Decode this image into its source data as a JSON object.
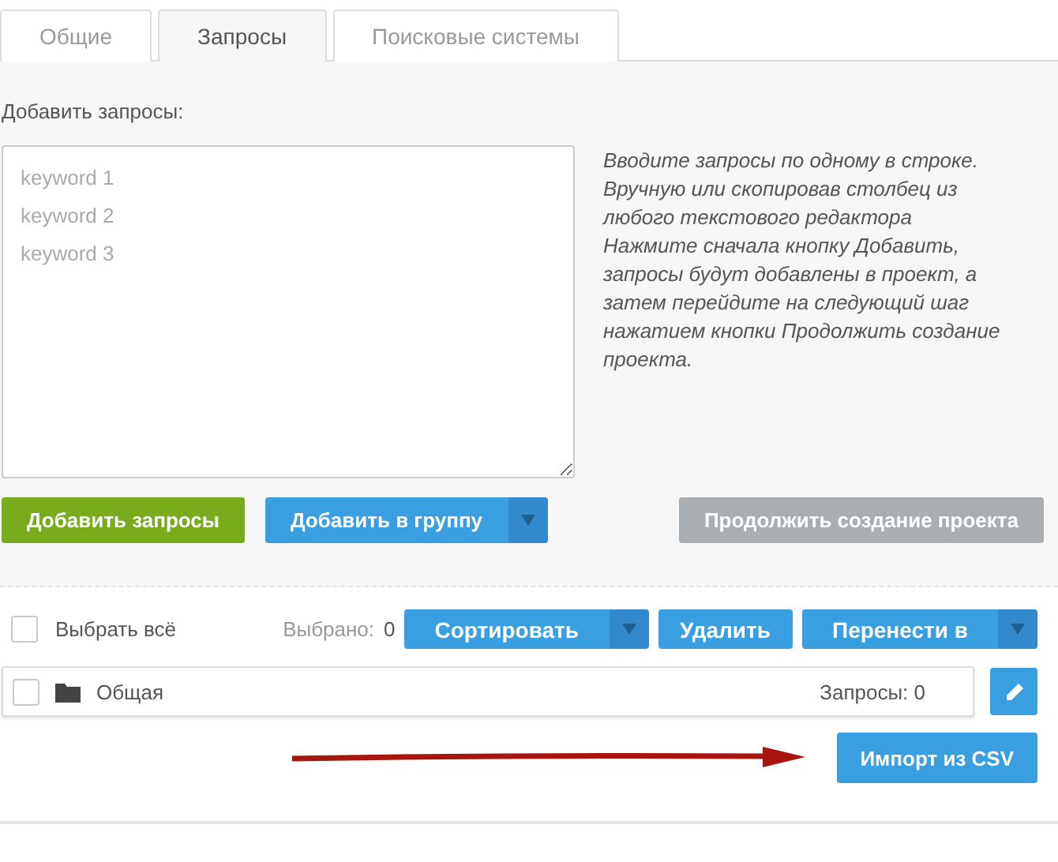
{
  "tabs": [
    {
      "label": "Общие",
      "selected": false
    },
    {
      "label": "Запросы",
      "selected": true
    },
    {
      "label": "Поисковые системы",
      "selected": false
    }
  ],
  "editor": {
    "label": "Добавить запросы:",
    "placeholder": "keyword 1\nkeyword 2\nkeyword 3",
    "hint": [
      "Вводите запросы по одному в строке. Вручную или скопировав столбец из любого текстового редактора",
      "Нажмите сначала кнопку Добавить, запросы будут добавлены в проект, а затем перейдите на следующий шаг нажатием кнопки Продолжить создание проекта."
    ],
    "buttons": [
      {
        "label": "Добавить запросы",
        "kind": "accent"
      },
      {
        "label": "Добавить в группу",
        "kind": "split"
      },
      {
        "label": "Продолжить создание проекта",
        "kind": "muted"
      }
    ]
  },
  "toolbar": {
    "select_all": {
      "label": "Выбрать всё",
      "checked": false
    },
    "selected_label": "Выбрано:",
    "selected_count": "0",
    "buttons": [
      {
        "label": "Сортировать",
        "kind": "split"
      },
      {
        "label": "Удалить",
        "kind": "plain"
      },
      {
        "label": "Перенести в",
        "kind": "split"
      }
    ]
  },
  "groups": [
    {
      "name": "Общая",
      "checked": false,
      "count_label": "Запросы:",
      "count": "0"
    }
  ],
  "import_button": {
    "label": "Импорт из CSV"
  }
}
